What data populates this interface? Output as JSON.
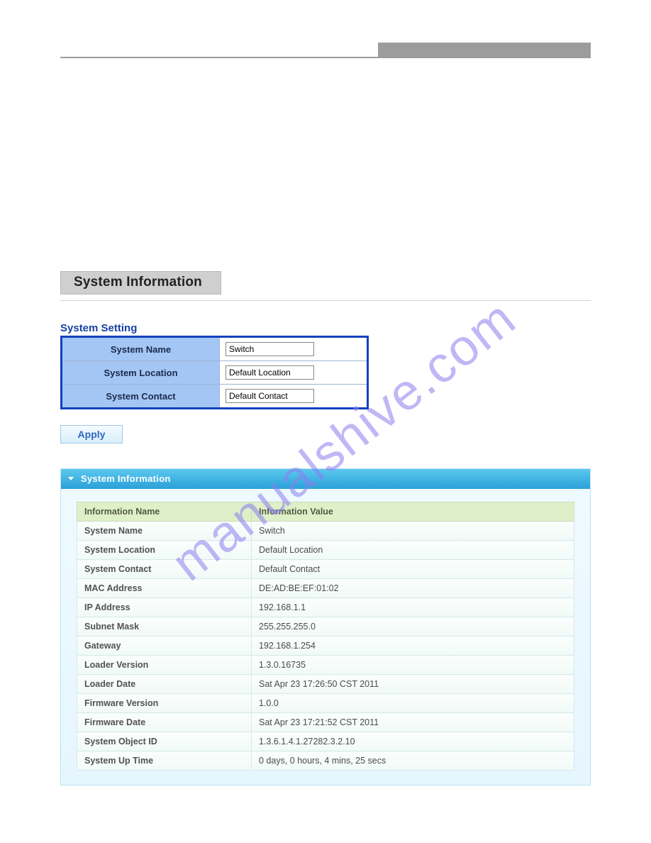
{
  "section_title": "System Information",
  "setting_heading": "System Setting",
  "settings": {
    "rows": [
      {
        "label": "System Name",
        "value": "Switch"
      },
      {
        "label": "System Location",
        "value": "Default Location"
      },
      {
        "label": "System Contact",
        "value": "Default Contact"
      }
    ]
  },
  "apply_label": "Apply",
  "panel_title": "System Information",
  "info_headers": {
    "col1": "Information Name",
    "col2": "Information Value"
  },
  "info_rows": [
    {
      "name": "System Name",
      "value": "Switch"
    },
    {
      "name": "System Location",
      "value": "Default Location"
    },
    {
      "name": "System Contact",
      "value": "Default Contact"
    },
    {
      "name": "MAC Address",
      "value": "DE:AD:BE:EF:01:02"
    },
    {
      "name": "IP Address",
      "value": "192.168.1.1"
    },
    {
      "name": "Subnet Mask",
      "value": "255.255.255.0"
    },
    {
      "name": "Gateway",
      "value": "192.168.1.254"
    },
    {
      "name": "Loader Version",
      "value": "1.3.0.16735"
    },
    {
      "name": "Loader Date",
      "value": "Sat Apr 23 17:26:50 CST 2011"
    },
    {
      "name": "Firmware Version",
      "value": "1.0.0"
    },
    {
      "name": "Firmware Date",
      "value": "Sat Apr 23 17:21:52 CST 2011"
    },
    {
      "name": "System Object ID",
      "value": "1.3.6.1.4.1.27282.3.2.10"
    },
    {
      "name": "System Up Time",
      "value": "0 days, 0 hours, 4 mins, 25 secs"
    }
  ],
  "watermark": "manualshive.com"
}
